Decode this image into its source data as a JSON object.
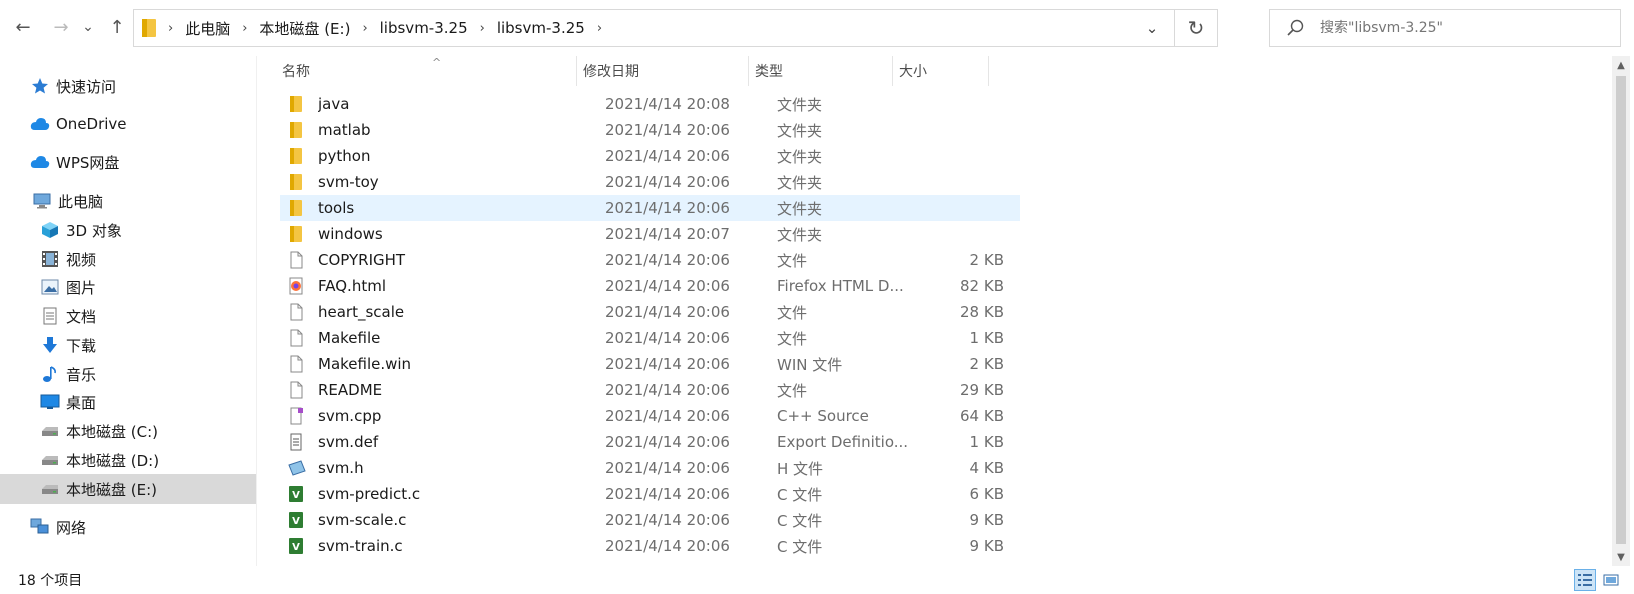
{
  "nav": {
    "back_glyph": "←",
    "forward_glyph": "→",
    "recent_glyph": "⌄",
    "up_glyph": "↑",
    "refresh_glyph": "↻",
    "dropdown_glyph": "⌄"
  },
  "breadcrumb": {
    "items": [
      "此电脑",
      "本地磁盘 (E:)",
      "libsvm-3.25",
      "libsvm-3.25"
    ],
    "separator": "›"
  },
  "search": {
    "placeholder": "搜索\"libsvm-3.25\""
  },
  "sidebar": {
    "items": [
      {
        "label": "快速访问",
        "icon": "star-icon"
      },
      {
        "label": "OneDrive",
        "icon": "cloud-icon"
      },
      {
        "label": "WPS网盘",
        "icon": "cloud-icon"
      },
      {
        "label": "此电脑",
        "icon": "computer-icon"
      },
      {
        "label": "3D 对象",
        "icon": "cube-icon"
      },
      {
        "label": "视频",
        "icon": "film-icon"
      },
      {
        "label": "图片",
        "icon": "picture-icon"
      },
      {
        "label": "文档",
        "icon": "document-icon"
      },
      {
        "label": "下载",
        "icon": "download-icon"
      },
      {
        "label": "音乐",
        "icon": "music-icon"
      },
      {
        "label": "桌面",
        "icon": "desktop-icon"
      },
      {
        "label": "本地磁盘 (C:)",
        "icon": "drive-icon"
      },
      {
        "label": "本地磁盘 (D:)",
        "icon": "drive-icon"
      },
      {
        "label": "本地磁盘 (E:)",
        "icon": "drive-icon"
      },
      {
        "label": "网络",
        "icon": "network-icon"
      }
    ]
  },
  "columns": {
    "name": "名称",
    "date": "修改日期",
    "type": "类型",
    "size": "大小",
    "sort_glyph": "^"
  },
  "files": [
    {
      "name": "java",
      "date": "2021/4/14 20:08",
      "type": "文件夹",
      "size": "",
      "icon": "folder-icon"
    },
    {
      "name": "matlab",
      "date": "2021/4/14 20:06",
      "type": "文件夹",
      "size": "",
      "icon": "folder-icon"
    },
    {
      "name": "python",
      "date": "2021/4/14 20:06",
      "type": "文件夹",
      "size": "",
      "icon": "folder-icon"
    },
    {
      "name": "svm-toy",
      "date": "2021/4/14 20:06",
      "type": "文件夹",
      "size": "",
      "icon": "folder-icon"
    },
    {
      "name": "tools",
      "date": "2021/4/14 20:06",
      "type": "文件夹",
      "size": "",
      "icon": "folder-icon"
    },
    {
      "name": "windows",
      "date": "2021/4/14 20:07",
      "type": "文件夹",
      "size": "",
      "icon": "folder-icon"
    },
    {
      "name": "COPYRIGHT",
      "date": "2021/4/14 20:06",
      "type": "文件",
      "size": "2 KB",
      "icon": "file-icon"
    },
    {
      "name": "FAQ.html",
      "date": "2021/4/14 20:06",
      "type": "Firefox HTML D...",
      "size": "82 KB",
      "icon": "firefox-icon"
    },
    {
      "name": "heart_scale",
      "date": "2021/4/14 20:06",
      "type": "文件",
      "size": "28 KB",
      "icon": "file-icon"
    },
    {
      "name": "Makefile",
      "date": "2021/4/14 20:06",
      "type": "文件",
      "size": "1 KB",
      "icon": "file-icon"
    },
    {
      "name": "Makefile.win",
      "date": "2021/4/14 20:06",
      "type": "WIN 文件",
      "size": "2 KB",
      "icon": "file-icon"
    },
    {
      "name": "README",
      "date": "2021/4/14 20:06",
      "type": "文件",
      "size": "29 KB",
      "icon": "file-icon"
    },
    {
      "name": "svm.cpp",
      "date": "2021/4/14 20:06",
      "type": "C++ Source",
      "size": "64 KB",
      "icon": "cpp-file-icon"
    },
    {
      "name": "svm.def",
      "date": "2021/4/14 20:06",
      "type": "Export Definitio...",
      "size": "1 KB",
      "icon": "def-file-icon"
    },
    {
      "name": "svm.h",
      "date": "2021/4/14 20:06",
      "type": "H 文件",
      "size": "4 KB",
      "icon": "header-file-icon"
    },
    {
      "name": "svm-predict.c",
      "date": "2021/4/14 20:06",
      "type": "C 文件",
      "size": "6 KB",
      "icon": "c-file-icon"
    },
    {
      "name": "svm-scale.c",
      "date": "2021/4/14 20:06",
      "type": "C 文件",
      "size": "9 KB",
      "icon": "c-file-icon"
    },
    {
      "name": "svm-train.c",
      "date": "2021/4/14 20:06",
      "type": "C 文件",
      "size": "9 KB",
      "icon": "c-file-icon"
    }
  ],
  "selected_file": "tools",
  "status": {
    "count": "18 个项目"
  },
  "colors": {
    "selection": "#e5f3ff",
    "sidebar_selected": "#d9d9d9",
    "folder": "#f4c542"
  }
}
